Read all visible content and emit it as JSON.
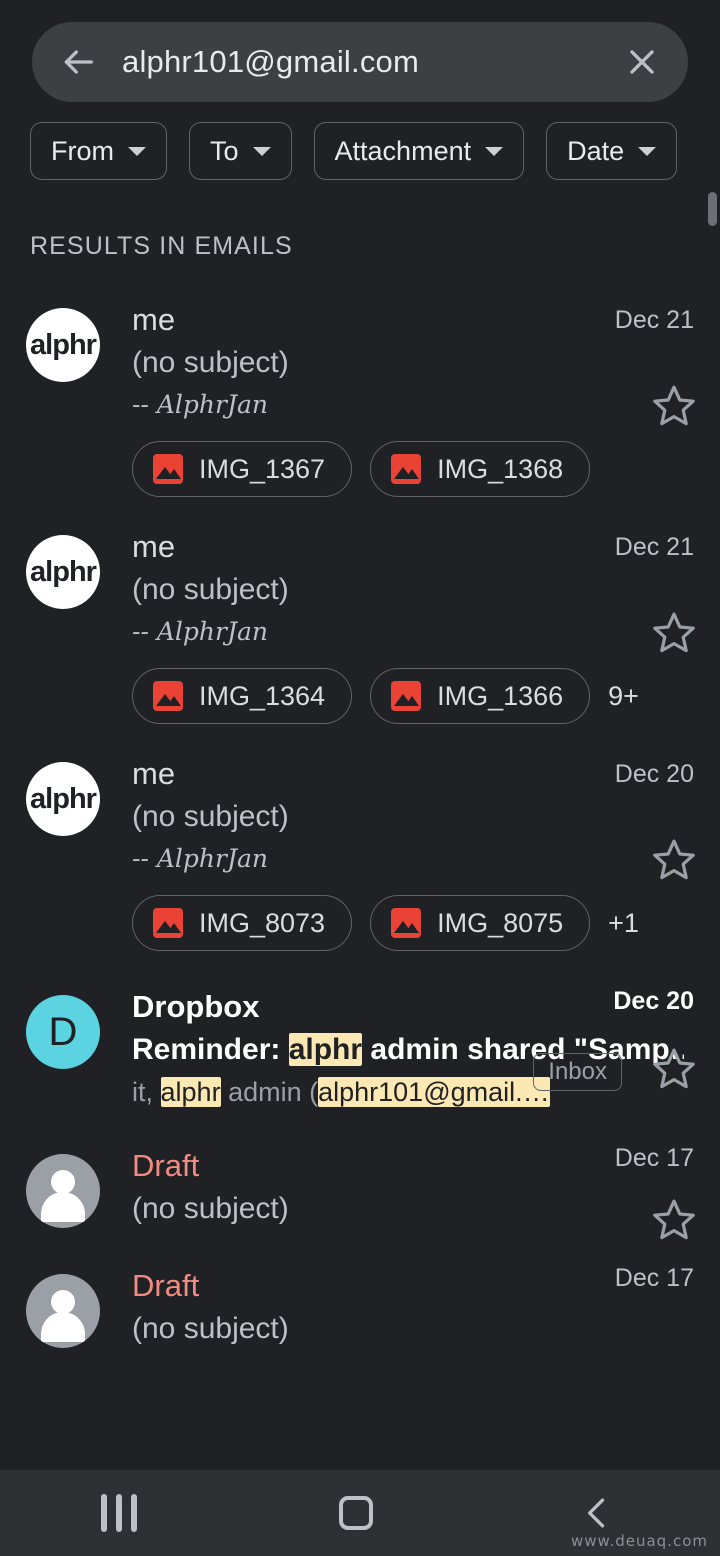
{
  "search": {
    "value": "alphr101@gmail.com",
    "back_icon": "arrow-back-icon",
    "clear_icon": "close-icon"
  },
  "filters": [
    {
      "label": "From"
    },
    {
      "label": "To"
    },
    {
      "label": "Attachment"
    },
    {
      "label": "Date"
    }
  ],
  "section_header": "RESULTS IN EMAILS",
  "emails": [
    {
      "avatar_type": "alphr",
      "avatar_text": "alphr",
      "sender": "me",
      "subject": "(no subject)",
      "snippet": "-- AlphrJan",
      "date": "Dec 21",
      "unread": false,
      "attachments": [
        {
          "name": "IMG_1367"
        },
        {
          "name": "IMG_1368"
        }
      ],
      "more_count": ""
    },
    {
      "avatar_type": "alphr",
      "avatar_text": "alphr",
      "sender": "me",
      "subject": "(no subject)",
      "snippet": "-- AlphrJan",
      "date": "Dec 21",
      "unread": false,
      "attachments": [
        {
          "name": "IMG_1364"
        },
        {
          "name": "IMG_1366"
        }
      ],
      "more_count": "9+"
    },
    {
      "avatar_type": "alphr",
      "avatar_text": "alphr",
      "sender": "me",
      "subject": "(no subject)",
      "snippet": "-- AlphrJan",
      "date": "Dec 20",
      "unread": false,
      "attachments": [
        {
          "name": "IMG_8073"
        },
        {
          "name": "IMG_8075"
        }
      ],
      "more_count": "+1"
    },
    {
      "avatar_type": "letter",
      "avatar_text": "D",
      "avatar_color": "#5bd3e0",
      "sender": "Dropbox",
      "subject_parts": [
        {
          "text": "Reminder: ",
          "highlight": false
        },
        {
          "text": "alphr",
          "highlight": true
        },
        {
          "text": " admin shared \"Samp…",
          "highlight": false
        }
      ],
      "snippet_parts": [
        {
          "text": "it, ",
          "highlight": false
        },
        {
          "text": "alphr",
          "highlight": true
        },
        {
          "text": " admin (",
          "highlight": false
        },
        {
          "text": "alphr101@gmail.…",
          "highlight": true
        }
      ],
      "date": "Dec 20",
      "unread": true,
      "label": "Inbox",
      "attachments": [],
      "more_count": ""
    },
    {
      "avatar_type": "person",
      "sender": "Draft",
      "is_draft": true,
      "subject": "(no subject)",
      "date": "Dec 17",
      "unread": false,
      "attachments": [],
      "more_count": ""
    },
    {
      "avatar_type": "person",
      "sender": "Draft",
      "is_draft": true,
      "subject": "(no subject)",
      "date": "Dec 17",
      "unread": false,
      "attachments": [],
      "more_count": ""
    }
  ],
  "navbar": {
    "recents": "recents-icon",
    "home": "home-icon",
    "back": "back-icon"
  },
  "watermark": "www.deuaq.com",
  "colors": {
    "background": "#202124",
    "searchbar": "#3c4043",
    "highlight": "#fce8b2",
    "draft": "#f28b82",
    "attachment_icon": "#ea4335",
    "dropbox_avatar": "#5bd3e0"
  }
}
